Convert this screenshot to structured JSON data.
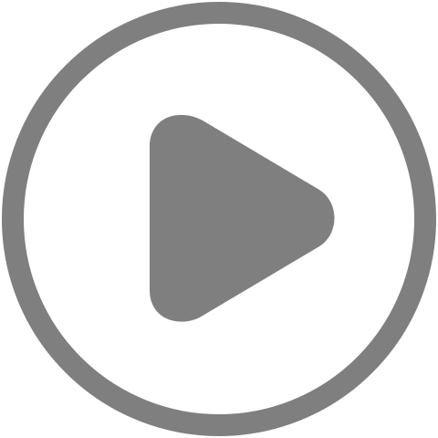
{
  "icon": {
    "name": "play-circle-icon",
    "color": "#7f7f7f",
    "background": "#ffffff"
  }
}
